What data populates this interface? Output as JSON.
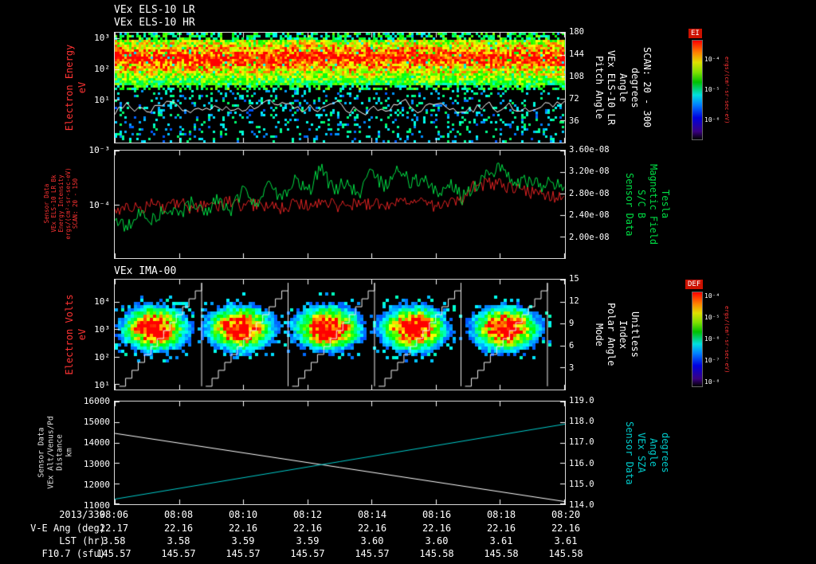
{
  "titles": {
    "line1": "VEx ELS-10 LR",
    "line2": "VEx ELS-10 HR",
    "panel3": "VEx IMA-00"
  },
  "panel1": {
    "left_label_lines": [
      "Electron Energy",
      "eV"
    ],
    "left_ticks": [
      "10³",
      "10²",
      "10¹"
    ],
    "right_ticks": [
      "180",
      "144",
      "108",
      "72",
      "36"
    ],
    "right_label_lines": [
      "Pitch Angle",
      "VEx ELS-10 LR",
      "Angle",
      "degrees",
      "SCAN: 20 - 300"
    ],
    "colorbar": {
      "title": "EI",
      "ticks": [
        "10⁻⁴",
        "10⁻⁵",
        "10⁻⁶"
      ],
      "units": "ergs/(cm²-sr-sec-eV)"
    }
  },
  "panel2": {
    "left_label_lines": [
      "Sensor Data",
      "VEx ELS-10 LR Bk",
      "Energy Intensity",
      "ergs/(cm²-sr-sec-eV)",
      "SCAN: 20 - 150"
    ],
    "left_ticks": [
      "10⁻³",
      "10⁻⁴"
    ],
    "right_ticks": [
      "3.60e-08",
      "3.20e-08",
      "2.80e-08",
      "2.40e-08",
      "2.00e-08"
    ],
    "right_label_lines": [
      "Sensor Data",
      "S/C B",
      "Magnetic Field",
      "Tesla"
    ]
  },
  "panel3": {
    "left_label_lines": [
      "Electron Volts",
      "eV"
    ],
    "left_ticks": [
      "10⁴",
      "10³",
      "10²",
      "10¹"
    ],
    "right_ticks": [
      "15",
      "12",
      "9",
      "6",
      "3"
    ],
    "right_label_lines": [
      "Mode",
      "Polar Angle",
      "Index",
      "Unitless"
    ],
    "colorbar": {
      "title": "DEF",
      "ticks": [
        "10⁻⁴",
        "10⁻⁵",
        "10⁻⁶",
        "10⁻⁷",
        "10⁻⁸"
      ],
      "units": "ergs/(cm²-sr-sec-eV)"
    }
  },
  "panel4": {
    "left_label_lines": [
      "Sensor Data",
      "VEx Alt/Venus/Pd",
      "Distance",
      "km"
    ],
    "left_ticks": [
      "16000",
      "15000",
      "14000",
      "13000",
      "12000",
      "11000"
    ],
    "right_ticks": [
      "119.0",
      "118.0",
      "117.0",
      "116.0",
      "115.0",
      "114.0"
    ],
    "right_label_lines": [
      "Sensor Data",
      "VEx SZA",
      "Angle",
      "degrees"
    ]
  },
  "footer": {
    "date": "2013/339",
    "row_labels": [
      "V-E Ang (deg)",
      "LST (hr)",
      "F10.7 (sfu)"
    ],
    "times": [
      "08:06",
      "08:08",
      "08:10",
      "08:12",
      "08:14",
      "08:16",
      "08:18",
      "08:20"
    ],
    "ve_ang": [
      "22.17",
      "22.16",
      "22.16",
      "22.16",
      "22.16",
      "22.16",
      "22.16",
      "22.16"
    ],
    "lst": [
      "3.58",
      "3.58",
      "3.59",
      "3.59",
      "3.60",
      "3.60",
      "3.61",
      "3.61"
    ],
    "f107": [
      "145.57",
      "145.57",
      "145.57",
      "145.57",
      "145.57",
      "145.58",
      "145.58",
      "145.58"
    ]
  },
  "chart_data": [
    {
      "type": "heatmap",
      "panel": "VEx ELS-10 LR/HR electron energy-time spectrogram",
      "x_axis": {
        "start": "08:06",
        "end": "08:20",
        "date": "2013/339"
      },
      "y_axis": {
        "label": "Electron Energy (eV)",
        "scale": "log",
        "ticks": [
          1000,
          100,
          10
        ]
      },
      "right_axis": {
        "label": "Pitch Angle VEx ELS-10 LR Angle (degrees), SCAN: 20 - 300",
        "ticks": [
          180,
          144,
          108,
          72,
          36
        ],
        "range": [
          0,
          180
        ]
      },
      "colorbar": {
        "label": "EI",
        "units": "ergs/(cm²-sr-sec-eV)",
        "ticks": [
          "1e-4",
          "1e-5",
          "1e-6"
        ]
      },
      "features": {
        "intense_band_eV": [
          20,
          600
        ],
        "band_peak_level": "red (~1e-4) centered near 100 eV across all times",
        "sparse_scatter": "scattered cyan/blue low-flux points below ~10 eV",
        "gaps": "narrow vertical telemetry gaps every ~30 s giving ~27 segments",
        "overlay": "white fluctuating pitch-angle trace in lower third of panel"
      }
    },
    {
      "type": "line",
      "x_axis": {
        "start": "08:06",
        "end": "08:20"
      },
      "left_axis": {
        "label": "VEx ELS-10 LR Bk Energy Intensity ergs/(cm²-sr-sec-eV) SCAN: 20 - 150",
        "scale": "log",
        "range": [
          1e-05,
          0.001
        ]
      },
      "right_axis": {
        "label": "S/C B Magnetic Field (Tesla)",
        "range": [
          1.6e-08,
          3.6e-08
        ],
        "ticks": [
          3.6e-08,
          3.2e-08,
          2.8e-08,
          2.4e-08,
          2e-08
        ]
      },
      "series": [
        {
          "name": "S/C B Magnetic Field",
          "color": "#00dd44",
          "axis": "right",
          "unit": "1e-8 Tesla",
          "values": [
            2.3,
            2.2,
            2.45,
            2.3,
            2.55,
            2.35,
            2.62,
            2.45,
            2.72,
            2.5,
            2.85,
            2.58,
            2.95,
            2.68,
            3.1,
            2.78,
            3.3,
            2.85,
            3.05,
            2.72,
            3.22,
            2.9,
            3.35,
            2.95,
            3.12,
            2.8,
            3.0,
            2.72,
            2.95,
            3.18,
            3.25,
            2.98,
            3.05,
            2.95,
            3.0,
            2.96
          ]
        },
        {
          "name": "ELS-10 LR Bk Energy Intensity",
          "color": "#dd2222",
          "axis": "left",
          "unit": "1e-4 ergs/(cm²-sr-sec-eV)",
          "values": [
            0.85,
            0.95,
            0.8,
            1.05,
            0.9,
            1.1,
            0.85,
            1.0,
            0.95,
            1.15,
            0.88,
            1.05,
            1.0,
            0.85,
            1.12,
            0.95,
            1.2,
            1.0,
            0.9,
            1.1,
            1.05,
            0.95,
            1.18,
            1.0,
            1.1,
            0.95,
            1.05,
            1.15,
            2.3,
            2.55,
            2.35,
            2.05,
            1.8,
            1.62,
            1.48,
            1.4
          ]
        }
      ]
    },
    {
      "type": "heatmap",
      "panel": "VEx IMA-00 ion energy-time spectrogram",
      "x_axis": {
        "start": "08:06",
        "end": "08:20"
      },
      "y_axis": {
        "label": "Electron Volts (eV)",
        "scale": "log",
        "ticks": [
          10000,
          1000,
          100,
          10
        ]
      },
      "right_axis": {
        "label": "Mode / Polar Angle Index (Unitless)",
        "ticks": [
          15,
          12,
          9,
          6,
          3
        ],
        "range": [
          0,
          15
        ]
      },
      "colorbar": {
        "label": "DEF",
        "units": "ergs/(cm²-sr-sec-eV)",
        "ticks": [
          "1e-4",
          "1e-5",
          "1e-6",
          "1e-7",
          "1e-8"
        ]
      },
      "blobs": [
        {
          "x_frac": 0.085,
          "peak_eV": 1000
        },
        {
          "x_frac": 0.275,
          "peak_eV": 1000
        },
        {
          "x_frac": 0.47,
          "peak_eV": 1200
        },
        {
          "x_frac": 0.66,
          "peak_eV": 1000
        },
        {
          "x_frac": 0.865,
          "peak_eV": 1000
        }
      ],
      "overlay": "white sawtooth polar-angle index ramps (0 to 15) repeating 5 times with vertical resets"
    },
    {
      "type": "line",
      "x_axis": {
        "start": "08:06",
        "end": "08:20"
      },
      "left_axis": {
        "label": "VEx Alt/Venus/Pd Distance (km)",
        "range": [
          11000,
          16000
        ]
      },
      "right_axis": {
        "label": "VEx SZA (degrees)",
        "range": [
          114,
          119
        ]
      },
      "series": [
        {
          "name": "Altitude",
          "color": "#ffffff",
          "axis": "left",
          "values": [
            14450,
            11130
          ]
        },
        {
          "name": "SZA",
          "color": "#00cccc",
          "axis": "right",
          "values": [
            114.25,
            117.9
          ]
        }
      ]
    }
  ]
}
